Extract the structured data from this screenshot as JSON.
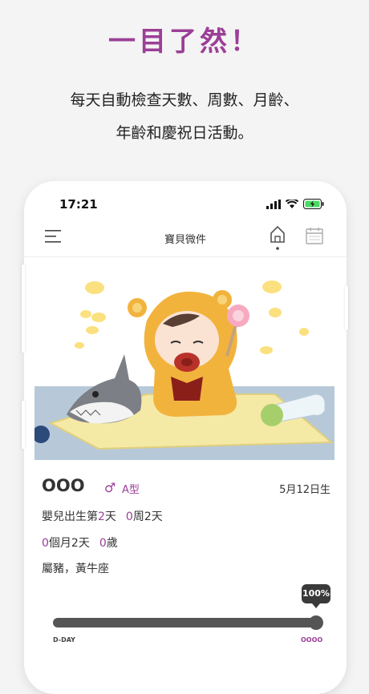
{
  "promo": {
    "headline": "一目了然！",
    "line1": "每天自動檢查天數、周數、月齡、",
    "line2": "年齡和慶祝日活動。"
  },
  "status_bar": {
    "time": "17:21",
    "icons": [
      "signal-icon",
      "wifi-icon",
      "battery-charging-icon"
    ]
  },
  "app_bar": {
    "title": "寶貝微件",
    "menu_icon": "menu-icon",
    "home_icon": "home-icon",
    "calendar_icon": "calendar-icon"
  },
  "baby": {
    "name": "OOO",
    "gender_symbol": "♂",
    "blood_type": "A型",
    "birthday": "5月12日生",
    "born_prefix": "嬰兒出生第",
    "day_num": "2",
    "day_unit": "天",
    "week_num": "0",
    "week_unit": "周",
    "week_days": "2天",
    "month_num": "0",
    "month_unit": "個月",
    "month_days": "2天",
    "age_num": "0",
    "age_unit": "歲",
    "zodiac": "屬豬，黃牛座"
  },
  "progress": {
    "percent_label": "100%",
    "value": 1.0,
    "start_label": "D-DAY",
    "end_label": "OOOO"
  },
  "colors": {
    "accent": "#9b3f97",
    "track": "#555555"
  }
}
